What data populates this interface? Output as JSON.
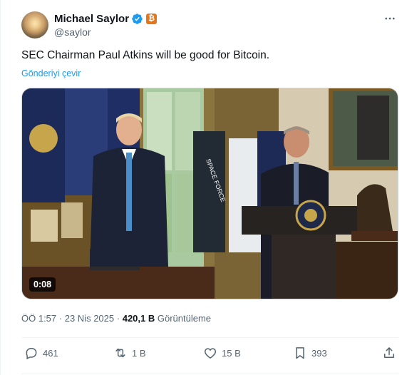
{
  "author": {
    "name": "Michael Saylor",
    "handle": "@saylor",
    "badge_symbol": "₿",
    "verified_color": "#1d9bf0",
    "badge_color": "#e2761b"
  },
  "tweet": {
    "text": "SEC Chairman Paul Atkins will be good for Bitcoin.",
    "translate_label": "Gönderiyi çevir",
    "video_duration": "0:08",
    "media_scene_text": "SPACE FORCE",
    "time": "ÖÖ 1:57",
    "date": "23 Nis 2025",
    "separator": "·",
    "views_count": "420,1 B",
    "views_label": "Görüntüleme"
  },
  "actions": {
    "reply_count": "461",
    "retweet_count": "1 B",
    "like_count": "15 B",
    "bookmark_count": "393"
  },
  "icons": [
    "verified-icon",
    "more-icon",
    "reply-icon",
    "retweet-icon",
    "like-icon",
    "bookmark-icon",
    "share-icon"
  ]
}
